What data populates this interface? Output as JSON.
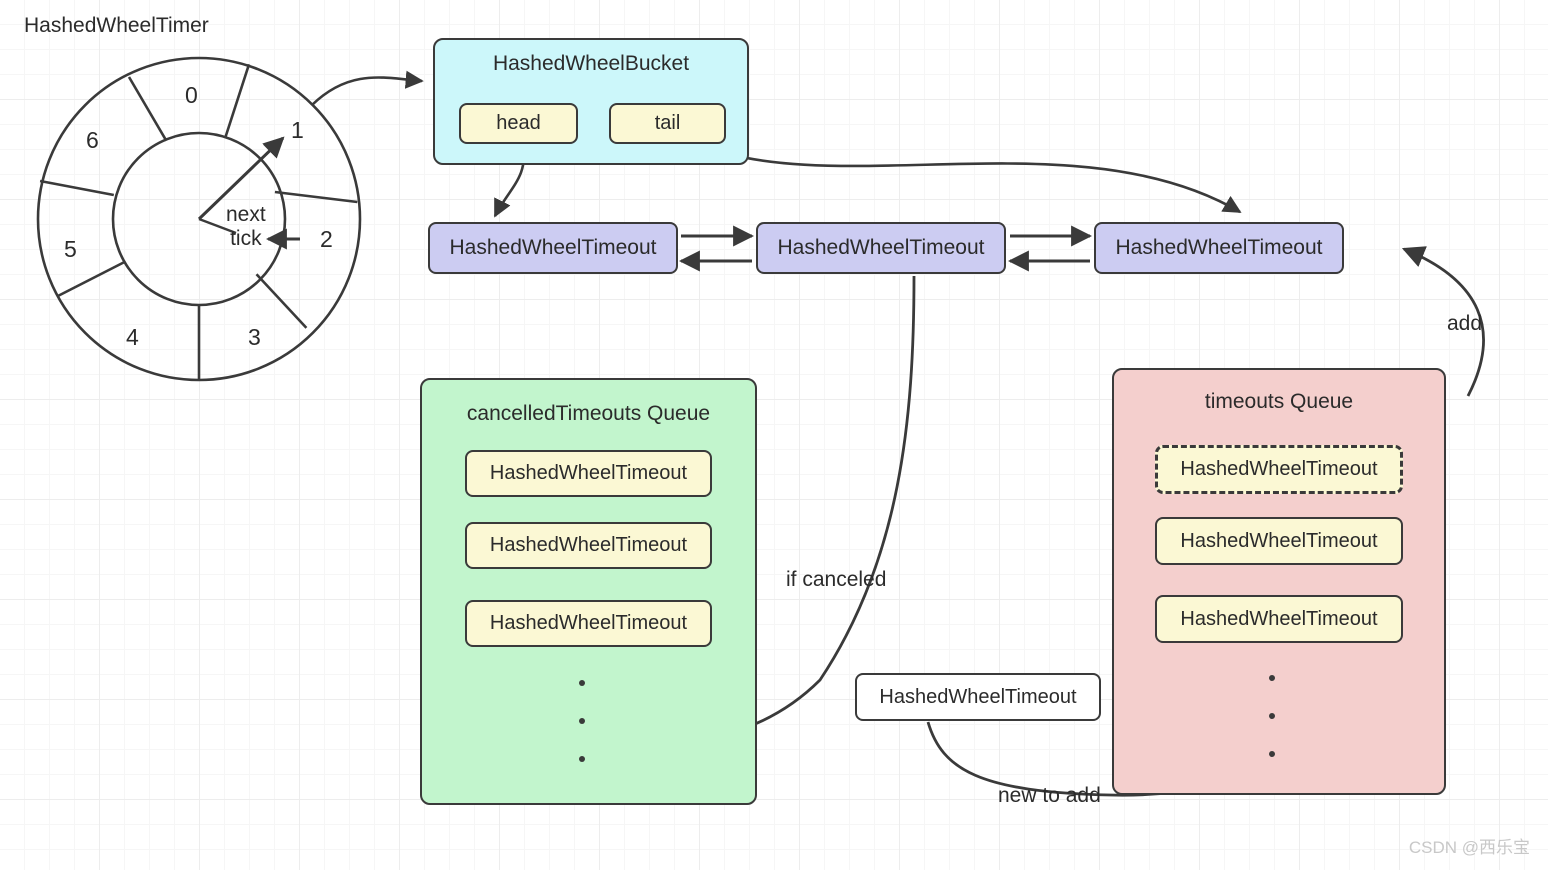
{
  "diagram": {
    "title": "HashedWheelTimer",
    "watermark": "CSDN @西乐宝"
  },
  "wheel": {
    "pointer_label_line1": "next",
    "pointer_label_line2": "tick",
    "slots": [
      {
        "index": "0"
      },
      {
        "index": "1"
      },
      {
        "index": "2"
      },
      {
        "index": "3"
      },
      {
        "index": "4"
      },
      {
        "index": "5"
      },
      {
        "index": "6"
      }
    ]
  },
  "bucket": {
    "title": "HashedWheelBucket",
    "head_label": "head",
    "tail_label": "tail"
  },
  "linked_list": {
    "nodes": [
      {
        "label": "HashedWheelTimeout"
      },
      {
        "label": "HashedWheelTimeout"
      },
      {
        "label": "HashedWheelTimeout"
      }
    ]
  },
  "cancelled_queue": {
    "title": "cancelledTimeouts Queue",
    "items": [
      {
        "label": "HashedWheelTimeout"
      },
      {
        "label": "HashedWheelTimeout"
      },
      {
        "label": "HashedWheelTimeout"
      }
    ]
  },
  "timeouts_queue": {
    "title": "timeouts Queue",
    "items": [
      {
        "label": "HashedWheelTimeout",
        "style": "dashed"
      },
      {
        "label": "HashedWheelTimeout",
        "style": "solid"
      },
      {
        "label": "HashedWheelTimeout",
        "style": "solid"
      }
    ]
  },
  "pending_timeout": {
    "label": "HashedWheelTimeout"
  },
  "edges": {
    "if_canceled": "if canceled",
    "new_to_add": "new to add",
    "add": "add"
  },
  "colors": {
    "bucket_fill": "#ccf7fa",
    "timeout_purple": "#ccccf2",
    "timeout_yellow": "#fbf8d4",
    "cancelled_queue_fill": "#c2f5cd",
    "timeouts_queue_fill": "#f4cfcd",
    "stroke": "#3a3a3a",
    "grid": "#ededed"
  }
}
